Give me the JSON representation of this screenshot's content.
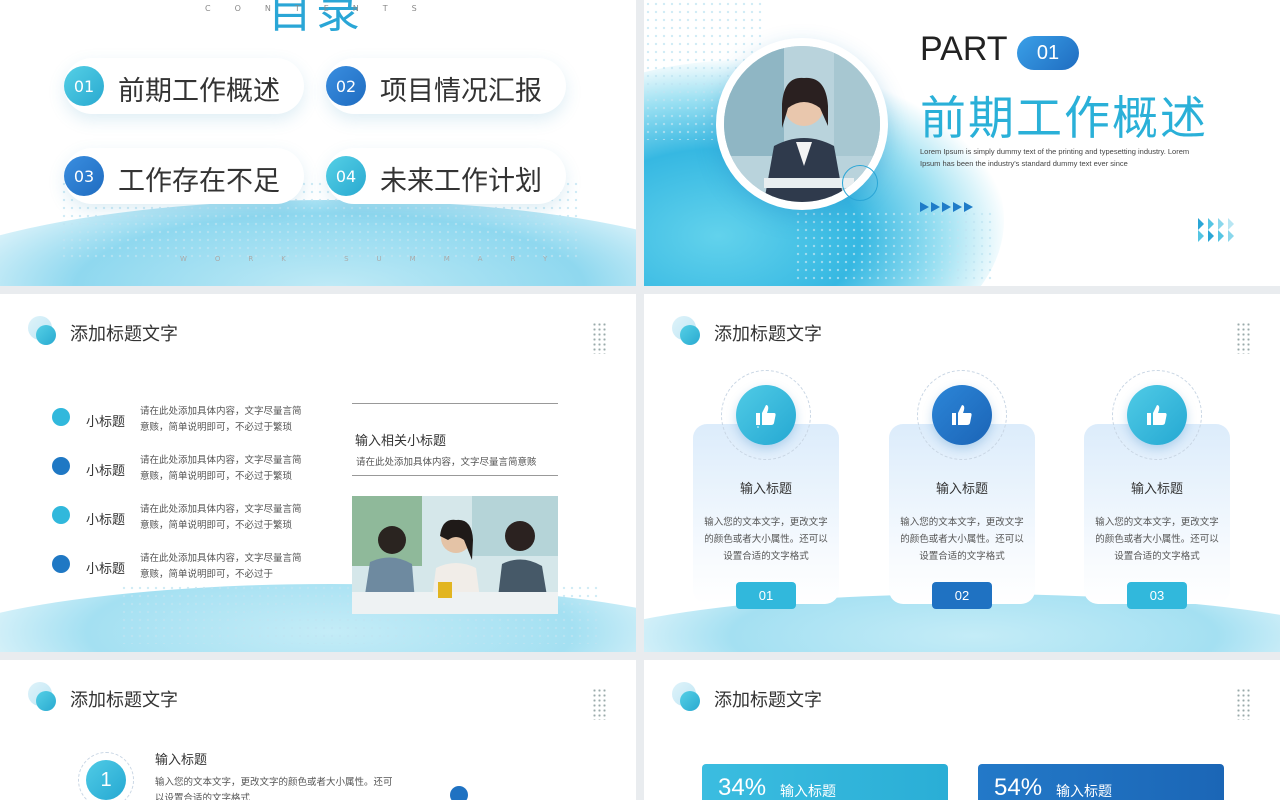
{
  "slide1": {
    "title": "目录",
    "subtitle": "CONTENTS",
    "items": [
      {
        "num": "01",
        "label": "前期工作概述"
      },
      {
        "num": "02",
        "label": "项目情况汇报"
      },
      {
        "num": "03",
        "label": "工作存在不足"
      },
      {
        "num": "04",
        "label": "未来工作计划"
      }
    ],
    "footer": "WORK SUMMARY"
  },
  "slide2": {
    "part": "PART",
    "badge": "01",
    "title": "前期工作概述",
    "desc": "Lorem Ipsum is simply dummy text of the printing and typesetting industry. Lorem Ipsum has been the industry's standard dummy text ever since"
  },
  "slide3": {
    "title": "添加标题文字",
    "rows": [
      {
        "label": "小标题",
        "text": "请在此处添加具体内容，文字尽量言简意赅，简单说明即可，不必过于繁琐"
      },
      {
        "label": "小标题",
        "text": "请在此处添加具体内容，文字尽量言简意赅，简单说明即可，不必过于繁琐"
      },
      {
        "label": "小标题",
        "text": "请在此处添加具体内容，文字尽量言简意赅，简单说明即可，不必过于繁琐"
      },
      {
        "label": "小标题",
        "text": "请在此处添加具体内容，文字尽量言简意赅，简单说明即可，不必过于"
      }
    ],
    "side_title": "输入相关小标题",
    "side_text": "请在此处添加具体内容，文字尽量言简意赅"
  },
  "slide4": {
    "title": "添加标题文字",
    "cards": [
      {
        "title": "输入标题",
        "text": "输入您的文本文字，更改文字的颜色或者大小属性。还可以设置合适的文字格式",
        "num": "01"
      },
      {
        "title": "输入标题",
        "text": "输入您的文本文字，更改文字的颜色或者大小属性。还可以设置合适的文字格式",
        "num": "02"
      },
      {
        "title": "输入标题",
        "text": "输入您的文本文字，更改文字的颜色或者大小属性。还可以设置合适的文字格式",
        "num": "03"
      }
    ]
  },
  "slide5": {
    "title": "添加标题文字",
    "num": "1",
    "item_title": "输入标题",
    "item_text": "输入您的文本文字，更改文字的颜色或者大小属性。还可以设置合适的文字格式"
  },
  "slide6": {
    "title": "添加标题文字",
    "stats": [
      {
        "pct": "34%",
        "label": "输入标题"
      },
      {
        "pct": "54%",
        "label": "输入标题"
      }
    ]
  },
  "colors": {
    "accent_light": "#2aa6d6",
    "accent_dark": "#1f6cc0"
  }
}
